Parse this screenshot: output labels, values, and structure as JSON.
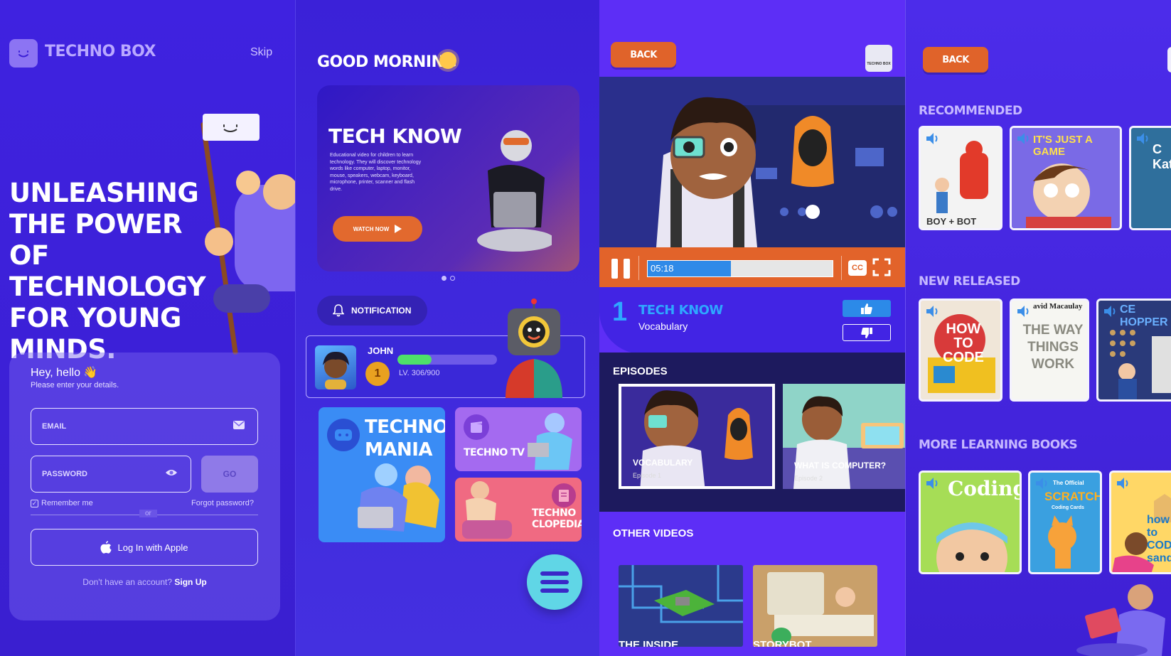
{
  "panel1": {
    "brand": "TECHNO BOX",
    "skip": "Skip",
    "hero": "UNLEASHING THE POWER OF TECHNOLOGY FOR YOUNG MINDS.",
    "greeting": "Hey, hello 👋",
    "subtitle": "Please enter your details.",
    "email_label": "EMAIL",
    "password_label": "PASSWORD",
    "go": "GO",
    "remember": "Remember me",
    "forgot": "Forgot password?",
    "or": "or",
    "apple_login": "Log In with Apple",
    "no_account": "Don't have an account?",
    "sign_up": "Sign Up"
  },
  "panel2": {
    "greeting": "GOOD MORNING",
    "banner_title": "TECH KNOW",
    "banner_desc": "Educational video for children to learn technology. They will discover technology words like computer, laptop, monitor, mouse, speakers, webcam, keyboard, microphone, printer, scanner and flash drive.",
    "watch_now": "WATCH NOW",
    "notification": "NOTIFICATION",
    "user_name": "JOHN",
    "level_text": "LV. 306/900",
    "level_progress": 0.34,
    "medal": "1",
    "tiles": {
      "mania": "TECHNO MANIA",
      "tv": "TECHNO TV",
      "clopedia": "TECHNO CLOPEDIA"
    }
  },
  "panel3": {
    "back": "BACK",
    "logo": "TECHNO BOX",
    "time": "05:18",
    "progress": 0.45,
    "cc": "CC",
    "episode_number": "1",
    "episode_title": "TECH KNOW",
    "episode_subtitle": "Vocabulary",
    "episodes_heading": "EPISODES",
    "episodes": [
      {
        "title": "VOCABULARY",
        "sub": "Episode 1"
      },
      {
        "title": "WHAT IS COMPUTER?",
        "sub": "Episode 2"
      }
    ],
    "other_heading": "OTHER VIDEOS",
    "other_videos": [
      {
        "title": "THE INSIDE"
      },
      {
        "title": "STORYBOT"
      }
    ]
  },
  "panel4": {
    "back": "BACK",
    "recommended": "RECOMMENDED",
    "new_released": "NEW RELEASED",
    "more_books": "MORE LEARNING BOOKS",
    "books": {
      "boy_bot": "BOY + BOT",
      "game": "IT'S JUST A GAME",
      "katherine": "C Kath",
      "how_to_code": "HOW TO CODE",
      "way_things": "THE WAY THINGS WORK",
      "author": "avid Macaulay",
      "hopper": "CE HOPPER",
      "coding": "Coding!",
      "scratch": "SCRATCH",
      "scratch_top": "The Official",
      "scratch_sub": "Coding Cards",
      "sandcastle": "how to COD a sandca"
    }
  },
  "colors": {
    "accent_orange": "#e2632a",
    "accent_blue": "#2ea7ff",
    "bg_purple": "#3b1fd6"
  }
}
